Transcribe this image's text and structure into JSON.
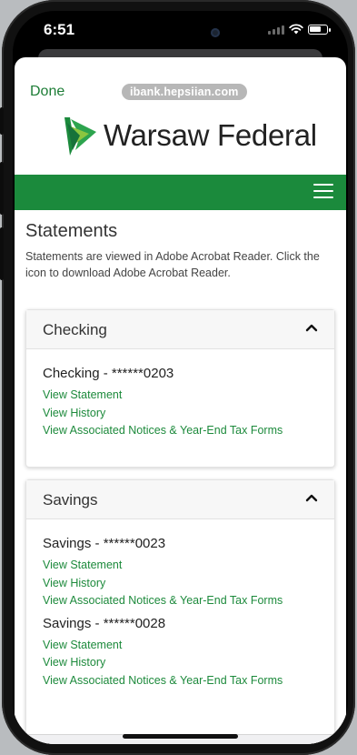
{
  "status": {
    "time": "6:51"
  },
  "browser": {
    "done_label": "Done",
    "url": "ibank.hepsiian.com"
  },
  "brand": {
    "name": "Warsaw Federal",
    "green": "#1b8a3c",
    "link_green": "#1d8a3c"
  },
  "page": {
    "title": "Statements",
    "intro": "Statements are viewed in Adobe Acrobat Reader. Click the icon to download Adobe Acrobat Reader."
  },
  "checking": {
    "title": "Checking",
    "accounts": [
      {
        "name": "Checking - ******0203",
        "links": [
          "View Statement",
          "View History",
          "View Associated Notices & Year-End Tax Forms"
        ]
      }
    ]
  },
  "savings": {
    "title": "Savings",
    "accounts": [
      {
        "name": "Savings - ******0023",
        "links": [
          "View Statement",
          "View History",
          "View Associated Notices & Year-End Tax Forms"
        ]
      },
      {
        "name": "Savings - ******0028",
        "links": [
          "View Statement",
          "View History",
          "View Associated Notices & Year-End Tax Forms"
        ]
      }
    ]
  },
  "toolbar": {
    "icons": [
      "back-icon",
      "forward-icon",
      "share-icon",
      "reload-icon"
    ]
  }
}
